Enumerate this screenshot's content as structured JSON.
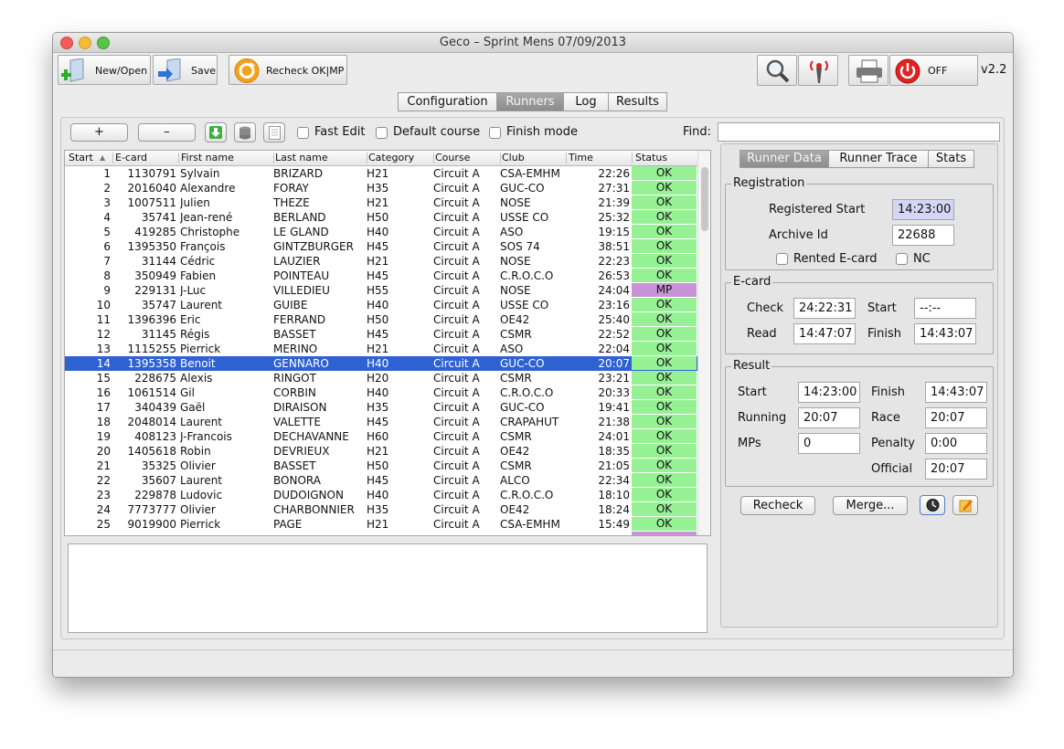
{
  "window": {
    "title": "Geco – Sprint Mens 07/09/2013"
  },
  "toolbar": {
    "new_open_label": "New/Open",
    "save_label": "Save",
    "recheck_label": "Recheck OK|MP",
    "station_label": "OFF",
    "version": "v2.2"
  },
  "tabs": [
    {
      "label": "Configuration",
      "active": false
    },
    {
      "label": "Runners",
      "active": true
    },
    {
      "label": "Log",
      "active": false
    },
    {
      "label": "Results",
      "active": false
    }
  ],
  "runners_toolbar": {
    "add_label": "+",
    "remove_label": "–",
    "fast_edit_label": "Fast Edit",
    "default_course_label": "Default course",
    "finish_mode_label": "Finish mode",
    "find_label": "Find:",
    "find_value": ""
  },
  "table": {
    "columns": [
      "Start",
      "E-card",
      "First name",
      "Last name",
      "Category",
      "Course",
      "Club",
      "Time",
      "Status"
    ],
    "selected_row": 14,
    "rows": [
      [
        "1",
        "1130791",
        "Sylvain",
        "BRIZARD",
        "H21",
        "Circuit A",
        "CSA-EMHM",
        "22:26",
        "OK"
      ],
      [
        "2",
        "2016040",
        "Alexandre",
        "FORAY",
        "H35",
        "Circuit A",
        "GUC-CO",
        "27:31",
        "OK"
      ],
      [
        "3",
        "1007511",
        "Julien",
        "THEZE",
        "H21",
        "Circuit A",
        "NOSE",
        "21:39",
        "OK"
      ],
      [
        "4",
        "35741",
        "Jean-rené",
        "BERLAND",
        "H50",
        "Circuit A",
        "USSE CO",
        "25:32",
        "OK"
      ],
      [
        "5",
        "419285",
        "Christophe",
        "LE GLAND",
        "H40",
        "Circuit A",
        "ASO",
        "19:15",
        "OK"
      ],
      [
        "6",
        "1395350",
        "François",
        "GINTZBURGER",
        "H45",
        "Circuit A",
        "SOS 74",
        "38:51",
        "OK"
      ],
      [
        "7",
        "31144",
        "Cédric",
        "LAUZIER",
        "H21",
        "Circuit A",
        "NOSE",
        "22:23",
        "OK"
      ],
      [
        "8",
        "350949",
        "Fabien",
        "POINTEAU",
        "H45",
        "Circuit A",
        "C.R.O.C.O",
        "26:53",
        "OK"
      ],
      [
        "9",
        "229131",
        "J-Luc",
        "VILLEDIEU",
        "H55",
        "Circuit A",
        "NOSE",
        "24:04",
        "MP"
      ],
      [
        "10",
        "35747",
        "Laurent",
        "GUIBE",
        "H40",
        "Circuit A",
        "USSE CO",
        "23:16",
        "OK"
      ],
      [
        "11",
        "1396396",
        "Eric",
        "FERRAND",
        "H50",
        "Circuit A",
        "OE42",
        "25:40",
        "OK"
      ],
      [
        "12",
        "31145",
        "Régis",
        "BASSET",
        "H45",
        "Circuit A",
        "CSMR",
        "22:52",
        "OK"
      ],
      [
        "13",
        "1115255",
        "Pierrick",
        "MERINO",
        "H21",
        "Circuit A",
        "ASO",
        "22:04",
        "OK"
      ],
      [
        "14",
        "1395358",
        "Benoit",
        "GENNARO",
        "H40",
        "Circuit A",
        "GUC-CO",
        "20:07",
        "OK"
      ],
      [
        "15",
        "228675",
        "Alexis",
        "RINGOT",
        "H20",
        "Circuit A",
        "CSMR",
        "23:21",
        "OK"
      ],
      [
        "16",
        "1061514",
        "Gil",
        "CORBIN",
        "H40",
        "Circuit A",
        "C.R.O.C.O",
        "20:33",
        "OK"
      ],
      [
        "17",
        "340439",
        "Gaël",
        "DIRAISON",
        "H35",
        "Circuit A",
        "GUC-CO",
        "19:41",
        "OK"
      ],
      [
        "18",
        "2048014",
        "Laurent",
        "VALETTE",
        "H45",
        "Circuit A",
        "CRAPAHUT",
        "21:38",
        "OK"
      ],
      [
        "19",
        "408123",
        "J-Francois",
        "DECHAVANNE",
        "H60",
        "Circuit A",
        "CSMR",
        "24:01",
        "OK"
      ],
      [
        "20",
        "1405618",
        "Robin",
        "DEVRIEUX",
        "H21",
        "Circuit A",
        "OE42",
        "18:35",
        "OK"
      ],
      [
        "21",
        "35325",
        "Olivier",
        "BASSET",
        "H50",
        "Circuit A",
        "CSMR",
        "21:05",
        "OK"
      ],
      [
        "22",
        "35607",
        "Laurent",
        "BONORA",
        "H45",
        "Circuit A",
        "ALCO",
        "22:34",
        "OK"
      ],
      [
        "23",
        "229878",
        "Ludovic",
        "DUDOIGNON",
        "H40",
        "Circuit A",
        "C.R.O.C.O",
        "18:10",
        "OK"
      ],
      [
        "24",
        "7773777",
        "Olivier",
        "CHARBONNIER",
        "H35",
        "Circuit A",
        "OE42",
        "18:24",
        "OK"
      ],
      [
        "25",
        "9019900",
        "Pierrick",
        "PAGE",
        "H21",
        "Circuit A",
        "CSA-EMHM",
        "15:49",
        "OK"
      ]
    ]
  },
  "right_tabs": [
    {
      "label": "Runner Data",
      "active": true
    },
    {
      "label": "Runner Trace",
      "active": false
    },
    {
      "label": "Stats",
      "active": false
    }
  ],
  "registration": {
    "legend": "Registration",
    "registered_start_label": "Registered Start",
    "registered_start_value": "14:23:00",
    "archive_id_label": "Archive Id",
    "archive_id_value": "22688",
    "rented_label": "Rented E-card",
    "nc_label": "NC"
  },
  "ecard": {
    "legend": "E-card",
    "check_label": "Check",
    "check_value": "24:22:31",
    "start_label": "Start",
    "start_value": "--:--",
    "read_label": "Read",
    "read_value": "14:47:07",
    "finish_label": "Finish",
    "finish_value": "14:43:07"
  },
  "result": {
    "legend": "Result",
    "start_label": "Start",
    "start_value": "14:23:00",
    "finish_label": "Finish",
    "finish_value": "14:43:07",
    "running_label": "Running",
    "running_value": "20:07",
    "race_label": "Race",
    "race_value": "20:07",
    "mps_label": "MPs",
    "mps_value": "0",
    "penalty_label": "Penalty",
    "penalty_value": "0:00",
    "official_label": "Official",
    "official_value": "20:07"
  },
  "actions": {
    "recheck_label": "Recheck",
    "merge_label": "Merge..."
  },
  "colors": {
    "selection": "#2f62d1",
    "ok": "#96f094",
    "mp": "#c993d8",
    "active_tab": "#8c8c8c"
  },
  "icons": [
    "new-open-icon",
    "save-icon",
    "recheck-icon",
    "search-icon",
    "antenna-icon",
    "printer-icon",
    "power-icon",
    "download-icon",
    "database-icon",
    "list-icon",
    "clock-icon",
    "edit-icon"
  ]
}
